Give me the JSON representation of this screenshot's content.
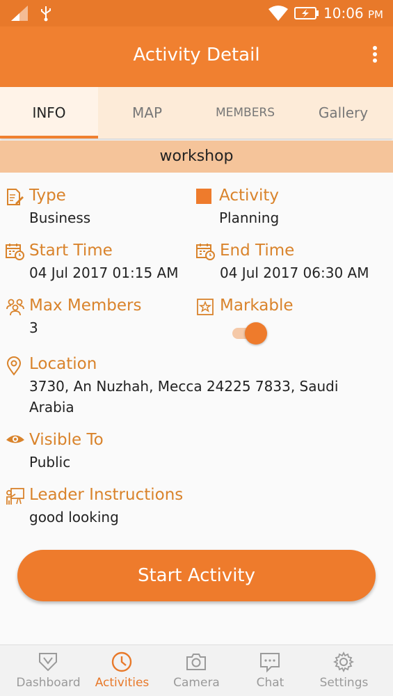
{
  "status_bar": {
    "time": "10:06",
    "ampm": "PM"
  },
  "app_bar": {
    "title": "Activity Detail"
  },
  "tabs": [
    {
      "label": "INFO",
      "active": true
    },
    {
      "label": "MAP",
      "active": false
    },
    {
      "label": "MEMBERS",
      "active": false
    },
    {
      "label": "Gallery",
      "active": false
    }
  ],
  "activity_name": "workshop",
  "fields": {
    "type": {
      "label": "Type",
      "value": "Business"
    },
    "activity": {
      "label": "Activity",
      "value": "Planning"
    },
    "start_time": {
      "label": "Start Time",
      "value": "04 Jul 2017 01:15 AM"
    },
    "end_time": {
      "label": "End Time",
      "value": "04 Jul 2017 06:30 AM"
    },
    "max_members": {
      "label": "Max Members",
      "value": "3"
    },
    "markable": {
      "label": "Markable",
      "enabled": true
    },
    "location": {
      "label": "Location",
      "value": "3730, An Nuzhah, Mecca 24225 7833, Saudi Arabia"
    },
    "visible_to": {
      "label": "Visible To",
      "value": "Public"
    },
    "leader_instructions": {
      "label": "Leader Instructions",
      "value": "good looking"
    }
  },
  "start_button": {
    "label": "Start Activity"
  },
  "bottom_nav": [
    {
      "label": "Dashboard",
      "icon": "dashboard-icon",
      "active": false
    },
    {
      "label": "Activities",
      "icon": "clock-icon",
      "active": true
    },
    {
      "label": "Camera",
      "icon": "camera-icon",
      "active": false
    },
    {
      "label": "Chat",
      "icon": "chat-icon",
      "active": false
    },
    {
      "label": "Settings",
      "icon": "gear-icon",
      "active": false
    }
  ],
  "colors": {
    "primary": "#f08030",
    "label": "#d9832b",
    "strip": "#f5c49a",
    "tab_bg": "#fdebd8"
  }
}
